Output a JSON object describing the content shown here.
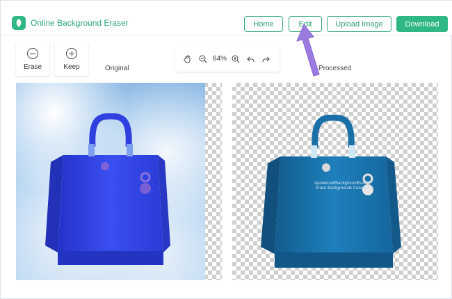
{
  "app": {
    "title": "Online Background Eraser",
    "accent": "#2fb884"
  },
  "nav": {
    "home": "Home",
    "edit": "Edit",
    "upload": "Upload Image",
    "download": "Download"
  },
  "tools": {
    "erase": "Erase",
    "keep": "Keep"
  },
  "zoom": {
    "value": "64%"
  },
  "panels": {
    "original": "Original",
    "processed": "Processed",
    "watermark_line1": "ApowersoftBackgroundEraser",
    "watermark_line2": "Erase Backgrounds Instantly"
  },
  "colors": {
    "original_bag": "#3548e6",
    "processed_bag": "#1b78b3",
    "arrow": "#9b7be0"
  }
}
